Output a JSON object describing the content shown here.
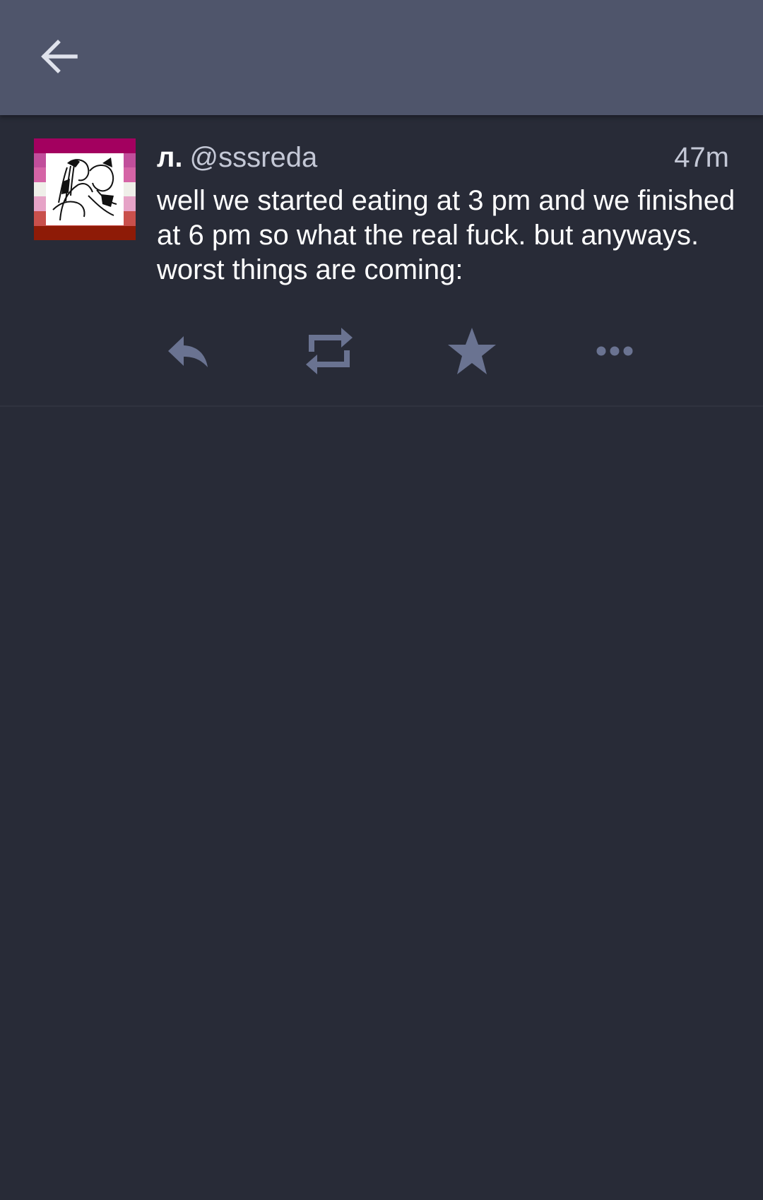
{
  "app_bar": {
    "back_icon": "arrow-left-icon",
    "color": "#4f556b"
  },
  "post": {
    "display_name": "л.",
    "handle": "@sssreda",
    "timestamp": "47m",
    "text": "well we started eating at 3 pm and we finished at 6 pm so what the real fuck. but anyways. worst things are coming:",
    "avatar": {
      "icon": "avatar-image",
      "stripe_colors": [
        "#a3005f",
        "#c14e9b",
        "#d564a6",
        "#efefe9",
        "#e6a3c7",
        "#c9504c",
        "#8e1b07"
      ]
    },
    "actions": [
      {
        "name": "reply",
        "icon": "reply-icon"
      },
      {
        "name": "boost",
        "icon": "repeat-icon"
      },
      {
        "name": "favourite",
        "icon": "star-icon"
      },
      {
        "name": "more",
        "icon": "more-horizontal-icon"
      }
    ]
  },
  "colors": {
    "background": "#282b37",
    "icon_muted": "#6a7391",
    "text_primary": "#ffffff",
    "text_secondary": "#c4c8d6"
  }
}
